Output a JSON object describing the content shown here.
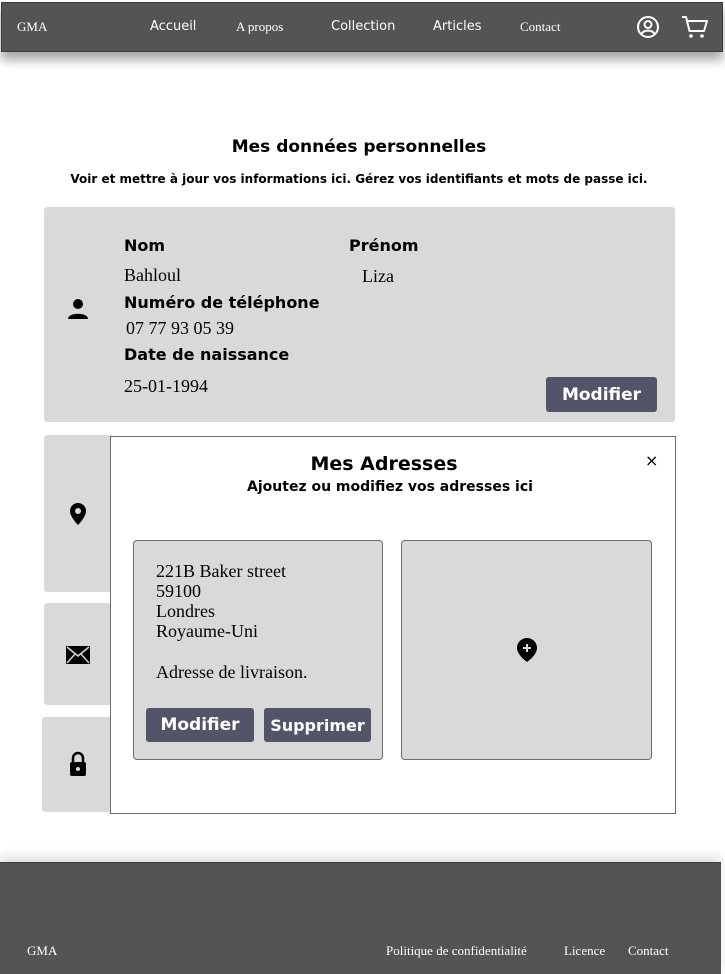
{
  "header": {
    "logo": "GMA",
    "nav": [
      "Accueil",
      "A propos",
      "Collection",
      "Articles",
      "Contact"
    ],
    "icons": [
      "account-icon",
      "cart-icon"
    ]
  },
  "page": {
    "title": "Mes données personnelles",
    "subtitle": "Voir et mettre à jour vos informations ici. Gérez vos identifiants et mots de passe ici."
  },
  "personal": {
    "last_name_label": "Nom",
    "last_name": "Bahloul",
    "first_name_label": "Prénom",
    "first_name": "Liza",
    "phone_label": "Numéro de téléphone",
    "phone": "07 77 93 05 39",
    "birth_label": "Date de naissance",
    "birth": "25-01-1994",
    "edit_button": "Modifier"
  },
  "addresses_modal": {
    "title": "Mes  Adresses",
    "subtitle": "Ajoutez ou modifiez vos adresses ici",
    "close": "×",
    "address": {
      "street": "221B Baker street",
      "postal_code": "59100",
      "city": "Londres",
      "country": "Royaume-Uni",
      "type": "Adresse de livraison."
    },
    "edit_button": "Modifier",
    "delete_button": "Supprimer"
  },
  "footer": {
    "logo": "GMA",
    "links": [
      "Politique de confidentialité",
      "Licence",
      "Contact"
    ]
  },
  "colors": {
    "header_bg": "#545454",
    "card_bg": "#d9d9d9",
    "button_bg": "#525467"
  }
}
